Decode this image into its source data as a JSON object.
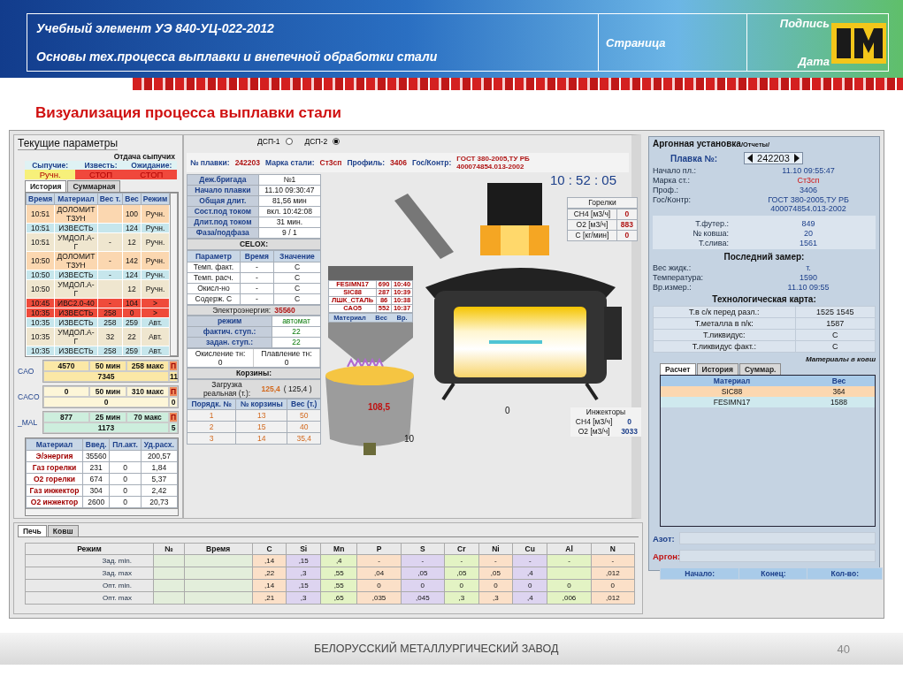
{
  "header": {
    "course_code": "Учебный элемент УЭ 840-УЦ-022-2012",
    "course_title": "Основы тех.процесса выплавки и внепечной обработки стали",
    "page_label": "Страница",
    "signature_label": "Подпись",
    "date_label": "Дата"
  },
  "slide_title": "Визуализация процесса выплавки стали",
  "current": {
    "title": "Текущие параметры",
    "feed_title": "Отдача сыпучих",
    "feeders": [
      {
        "label": "Сыпучие:",
        "status": "Ручн.",
        "color": "#f7f07a"
      },
      {
        "label": "Известь:",
        "status": "СТОП",
        "color": "#f0483c"
      },
      {
        "label": "Ожидание:",
        "status": "СТОП",
        "color": "#f0483c"
      }
    ],
    "tabs": [
      {
        "label": "История",
        "selected": true
      },
      {
        "label": "Суммарная",
        "selected": false
      }
    ],
    "history": {
      "columns": [
        "Время",
        "Материал",
        "Вес т.",
        "Вес",
        "Режим"
      ],
      "rows": [
        {
          "cells": [
            "10:51",
            "ДОЛОМИТ ТЗУН",
            null,
            "100",
            "Ручн."
          ],
          "color": "#fbd7b0"
        },
        {
          "cells": [
            "10:51",
            "ИЗВЕСТЬ",
            null,
            "124",
            "Ручн."
          ],
          "color": "#c6e6ec"
        },
        {
          "cells": [
            "10:51",
            "УМДОЛ.А-Г",
            "-",
            "12",
            "Ручн."
          ],
          "color": "#efe6cf"
        },
        {
          "cells": [
            "10:50",
            "ДОЛОМИТ ТЗУН",
            "-",
            "142",
            "Ручн."
          ],
          "color": "#fbd7b0"
        },
        {
          "cells": [
            "10:50",
            "ИЗВЕСТЬ",
            "-",
            "124",
            "Ручн."
          ],
          "color": "#c6e6ec"
        },
        {
          "cells": [
            "10:50",
            "УМДОЛ.А-Г",
            null,
            "12",
            "Ручн."
          ],
          "color": "#efe6cf"
        },
        {
          "cells": [
            "10:45",
            "ИВС2.0-40",
            "-",
            "104",
            ">"
          ],
          "color": "#ef4b3b"
        },
        {
          "cells": [
            "10:35",
            "ИЗВЕСТЬ",
            "258",
            "0",
            ">"
          ],
          "color": "#ef4b3b"
        },
        {
          "cells": [
            "10:35",
            "ИЗВЕСТЬ",
            "258",
            "259",
            "Авт."
          ],
          "color": "#c6e6ec"
        },
        {
          "cells": [
            "10:35",
            "УМДОЛ.А-Г",
            "32",
            "22",
            "Авт."
          ],
          "color": "#efe6cf"
        },
        {
          "cells": [
            "10:35",
            "ИЗВЕСТЬ",
            "258",
            "259",
            "Авт."
          ],
          "color": "#c6e6ec"
        }
      ]
    },
    "bunkers": [
      {
        "label": "CAO",
        "set": "4570",
        "min": "50 мин",
        "max": "258 макс",
        "flag": "П",
        "total": "7345",
        "count": "11",
        "color": "#fbe8a6"
      },
      {
        "label": "CACO",
        "set": "0",
        "min": "50 мин",
        "max": "310 макс",
        "flag": "П",
        "total": "0",
        "count": "0",
        "color": "#fdf6d8"
      },
      {
        "label": "_MAL",
        "set": "877",
        "min": "25 мин",
        "max": "70 макс",
        "flag": "П",
        "total": "1173",
        "count": "5",
        "color": "#cdeedd"
      }
    ],
    "consumption": {
      "columns": [
        "Материал",
        "Введ.",
        "Пл.акт.",
        "Уд.расх."
      ],
      "rows": [
        [
          "Э/энергия",
          "35560",
          null,
          "200,57"
        ],
        [
          "Газ горелки",
          "231",
          "0",
          "1,84"
        ],
        [
          "О2 горелки",
          "674",
          "0",
          "5,37"
        ],
        [
          "Газ инжектор",
          "304",
          "0",
          "2,42"
        ],
        [
          "О2 инжектор",
          "2600",
          "0",
          "20,73"
        ]
      ]
    }
  },
  "furnace_view": {
    "units": [
      {
        "label": "ДСП-1",
        "selected": false
      },
      {
        "label": "ДСП-2",
        "selected": true
      }
    ],
    "heat": [
      {
        "label": "№ плавки:",
        "value": "242203"
      },
      {
        "label": "Марка стали:",
        "value": "Ст3сп"
      },
      {
        "label": "Профиль:",
        "value": "3406"
      },
      {
        "label": "Гос/Контр:",
        "value": "ГОСТ 380-2005,ТУ РБ 400074854.013-2002"
      }
    ],
    "clock": "10 : 52 : 05",
    "shift": [
      {
        "label": "Деж.бригада",
        "value": "№1"
      },
      {
        "label": "Начало плавки",
        "value": "11.10 09:30:47"
      },
      {
        "label": "Общая длит.",
        "value": "81,56 мин"
      },
      {
        "label": "Сост.под током",
        "value": "вкл. 10:42:08"
      },
      {
        "label": "Длит.под током",
        "value": "31 мин."
      },
      {
        "label": "Фаза/подфаза",
        "value": "9 / 1"
      }
    ],
    "celox": {
      "title": "CELOX:",
      "columns": [
        "Параметр",
        "Время",
        "Значение"
      ],
      "rows": [
        [
          "Темп. факт.",
          "-",
          "C"
        ],
        [
          "Темп. расч.",
          "-",
          "C"
        ],
        [
          "Окисл-но",
          "-",
          "C"
        ],
        [
          "Содерж. С",
          "-",
          "C"
        ]
      ]
    },
    "energy": {
      "label": "Электроэнергия:",
      "value": "35560"
    },
    "mode": [
      {
        "label": "режим",
        "value": "автомат"
      },
      {
        "label": "фактич. ступ.:",
        "value": "22"
      },
      {
        "label": "задан. ступ.:",
        "value": "22"
      }
    ],
    "melting": [
      {
        "label": "Окисление тн:",
        "value": "0"
      },
      {
        "label": "Плавление тн:",
        "value": "0"
      }
    ],
    "baskets": {
      "title": "Корзины:",
      "load_label": "Загрузка реальная (т.):",
      "load": "125,4",
      "load_planned": "( 125,4 )",
      "columns": [
        "Порядк. №",
        "№ корзины",
        "Вес (т.)"
      ],
      "rows": [
        [
          "1",
          "13",
          "50"
        ],
        [
          "2",
          "15",
          "40"
        ],
        [
          "3",
          "14",
          "35,4"
        ]
      ]
    },
    "hopper": {
      "legend": [
        "Материал",
        "Вес",
        "Вр."
      ],
      "rows": [
        [
          "FESIMN17",
          "690",
          "10:40"
        ],
        [
          "SIC88",
          "287",
          "10:39"
        ],
        [
          "ЛШК_СТАЛЬ",
          "86",
          "10:38"
        ],
        [
          "CAO5",
          "552",
          "10:37"
        ]
      ]
    },
    "ladle": {
      "temperature": "108,5",
      "number": "10"
    },
    "furnace_label": "0",
    "burners": {
      "title": "Горелки",
      "rows": [
        [
          "CH4 [м3/ч]",
          "0"
        ],
        [
          "O2 [м3/ч]",
          "883"
        ],
        [
          "C [кг/мин]",
          "0"
        ]
      ]
    },
    "injectors": {
      "title": "Инжекторы",
      "rows": [
        [
          "CH4 [м3/ч]",
          "0"
        ],
        [
          "O2 [м3/ч]",
          "3033"
        ]
      ]
    }
  },
  "argon": {
    "title": "Аргонная установка",
    "subtitle": "/Отчеты/",
    "heat_label": "Плавка №:",
    "heat": "242203",
    "info": [
      {
        "label": "Начало пл.:",
        "value": "11.10 09:55:47"
      },
      {
        "label": "Марка ст.:",
        "value": "Ст3сп"
      },
      {
        "label": "Проф.:",
        "value": "3406"
      },
      {
        "label": "Гос/Контр:",
        "value": "ГОСТ 380-2005,ТУ РБ 400074854.013-2002"
      }
    ],
    "ladle": [
      {
        "label": "Т.футер.:",
        "value": "849"
      },
      {
        "label": "№ ковша:",
        "value": "20"
      },
      {
        "label": "Т.слива:",
        "value": "1561"
      }
    ],
    "last_title": "Последний замер:",
    "last": [
      {
        "label": "Вес жидк.:",
        "value": "т."
      },
      {
        "label": "Температура:",
        "value": "1590"
      },
      {
        "label": "Вр.измер.:",
        "value": "11.10 09:55"
      }
    ],
    "map_title": "Технологическая карта:",
    "map": [
      {
        "label": "Т.в с/к перед разл.:",
        "value": "1525 1545"
      },
      {
        "label": "Т.металла в п/к:",
        "value": "1587"
      },
      {
        "label": "Т.ликвидус:",
        "value": "C"
      },
      {
        "label": "Т.ликвидус факт.:",
        "value": "C"
      }
    ],
    "materials_title": "Материалы в ковш",
    "tabs": [
      {
        "label": "Расчет",
        "selected": true
      },
      {
        "label": "История",
        "selected": false
      },
      {
        "label": "Суммар.",
        "selected": false
      }
    ],
    "materials": {
      "columns": [
        "Материал",
        "Вес"
      ],
      "rows": [
        {
          "cells": [
            "SIC88",
            "364"
          ],
          "color": "#fbd7b0"
        },
        {
          "cells": [
            "FESIMN17",
            "1588"
          ],
          "color": "#cfe9ee"
        }
      ]
    },
    "nitrogen_label": "Азот:",
    "argon_label": "Аргон:",
    "blow_columns": [
      "Начало:",
      "Конец:",
      "Кол-во:"
    ]
  },
  "chemistry": {
    "tabs": [
      {
        "label": "Печь",
        "selected": true
      },
      {
        "label": "Ковш",
        "selected": false
      }
    ],
    "columns": [
      {
        "label": "Режим"
      },
      {
        "label": "№",
        "color": "#e3eedb"
      },
      {
        "label": "Время",
        "color": "#e3eedb"
      },
      {
        "label": "C",
        "color": "#fbe0c8"
      },
      {
        "label": "Si",
        "color": "#ddd4f0"
      },
      {
        "label": "Mn",
        "color": "#e3f3c4"
      },
      {
        "label": "P",
        "color": "#fbe0c8"
      },
      {
        "label": "S",
        "color": "#ddd4f0"
      },
      {
        "label": "Cr",
        "color": "#e3f3c4"
      },
      {
        "label": "Ni",
        "color": "#fbe0c8"
      },
      {
        "label": "Cu",
        "color": "#ddd4f0"
      },
      {
        "label": "Al",
        "color": "#e3f3c4"
      },
      {
        "label": "N",
        "color": "#fbe0c8"
      }
    ],
    "rows": [
      [
        "Зад. min.",
        null,
        null,
        ",14",
        ",15",
        ",4",
        "-",
        "-",
        "-",
        "-",
        "-",
        "-",
        "-"
      ],
      [
        "Зад. max",
        null,
        null,
        ",22",
        ",3",
        ",55",
        ",04",
        ",05",
        ",05",
        ",05",
        ",4",
        null,
        ",012"
      ],
      [
        "Опт. min.",
        null,
        null,
        ",14",
        ",15",
        ",55",
        "0",
        "0",
        "0",
        "0",
        "0",
        "0",
        "0"
      ],
      [
        "Опт. max",
        null,
        null,
        ",21",
        ",3",
        ",65",
        ",035",
        ",045",
        ",3",
        ",3",
        ",4",
        ",006",
        ",012"
      ]
    ]
  },
  "footer": {
    "company": "БЕЛОРУССКИЙ МЕТАЛЛУРГИЧЕСКИЙ ЗАВОД",
    "page": "40"
  }
}
